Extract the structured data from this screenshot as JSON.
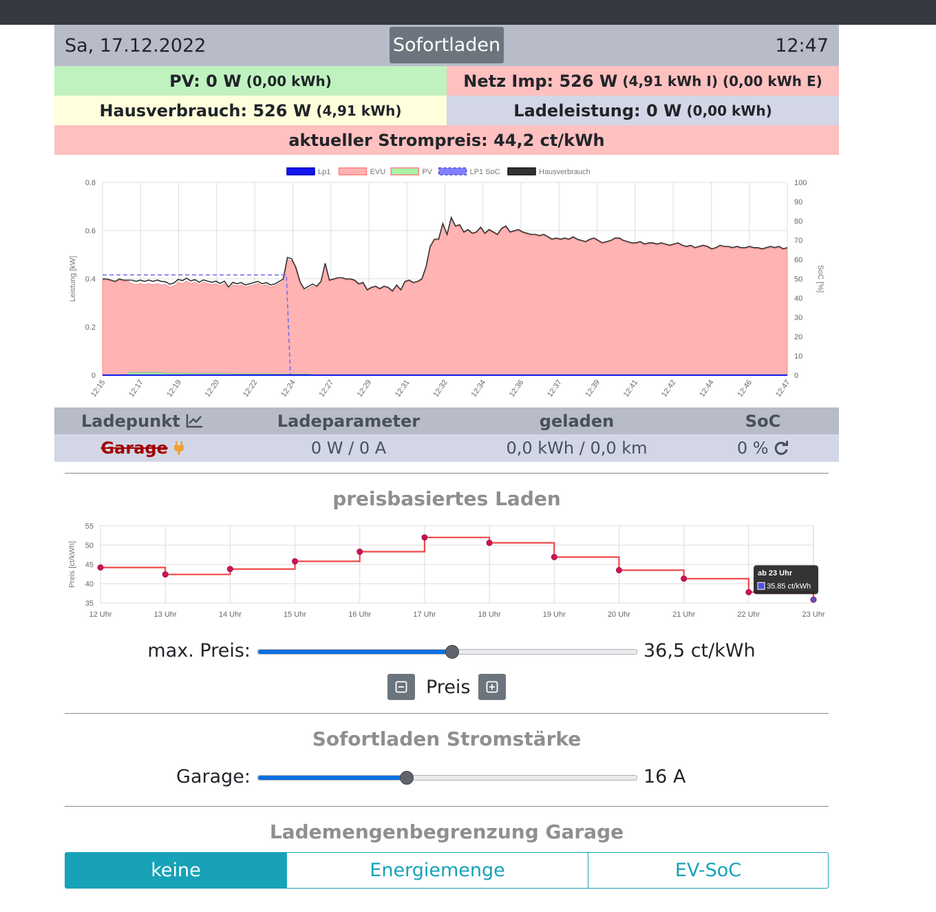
{
  "header": {
    "date": "Sa, 17.12.2022",
    "mode": "Sofortladen",
    "time": "12:47"
  },
  "summary": {
    "pv_label": "PV: 0 W",
    "pv_sub": "(0,00 kWh)",
    "netz_label": "Netz Imp: 526 W",
    "netz_sub": "(4,91 kWh I) (0,00 kWh E)",
    "haus_label": "Hausverbrauch: 526 W",
    "haus_sub": "(4,91 kWh)",
    "lade_label": "Ladeleistung: 0 W",
    "lade_sub": "(0,00 kWh)",
    "preis_label": "aktueller Strompreis: 44,2 ct/kWh"
  },
  "colors": {
    "header_bg": "#b8bcc8",
    "pv_bg": "#c0f2c0",
    "netz_bg": "#ffc0c0",
    "haus_bg": "#ffffdc",
    "lade_bg": "#d2d6e6",
    "accent": "#17a2b8",
    "slider_fill": "#0b6fe0"
  },
  "chart_data": [
    {
      "type": "area",
      "legend": [
        "Lp1",
        "EVU",
        "PV",
        "LP1 SoC",
        "Hausverbrauch"
      ],
      "legend_colors": [
        "#1515f0",
        "#ffb3b3",
        "#a8f5a8",
        "#8080ff",
        "#333333"
      ],
      "legend_placement": "top",
      "ylabel_left": "Leistung [kW]",
      "ylabel_right": "SoC [%]",
      "ylim_left": [
        0,
        0.8
      ],
      "yticks_left": [
        "0",
        "0.2",
        "0.4",
        "0.6",
        "0.8"
      ],
      "ylim_right": [
        0,
        100
      ],
      "yticks_right": [
        "0",
        "10",
        "20",
        "30",
        "40",
        "50",
        "60",
        "70",
        "80",
        "90",
        "100"
      ],
      "x_ticks": [
        "12:15",
        "12:17",
        "12:19",
        "12:20",
        "12:22",
        "12:24",
        "12:27",
        "12:29",
        "12:31",
        "12:32",
        "12:34",
        "12:36",
        "12:37",
        "12:39",
        "12:41",
        "12:42",
        "12:44",
        "12:46",
        "12:47"
      ],
      "grid": true,
      "series": [
        {
          "name": "EVU",
          "values": [
            0.395,
            0.395,
            0.39,
            0.385,
            0.395,
            0.39,
            0.39,
            0.38,
            0.375,
            0.38,
            0.375,
            0.38,
            0.375,
            0.38,
            0.375,
            0.375,
            0.365,
            0.37,
            0.385,
            0.38,
            0.39,
            0.38,
            0.385,
            0.375,
            0.385,
            0.38,
            0.375,
            0.38,
            0.37,
            0.38,
            0.355,
            0.375,
            0.37,
            0.375,
            0.365,
            0.37,
            0.375,
            0.38,
            0.37,
            0.375,
            0.365,
            0.37,
            0.38,
            0.39,
            0.48,
            0.475,
            0.44,
            0.38,
            0.35,
            0.36,
            0.37,
            0.365,
            0.385,
            0.46,
            0.39,
            0.395,
            0.4,
            0.4,
            0.395,
            0.395,
            0.39,
            0.375,
            0.38,
            0.35,
            0.36,
            0.365,
            0.355,
            0.365,
            0.36,
            0.345,
            0.37,
            0.35,
            0.385,
            0.39,
            0.38,
            0.385,
            0.395,
            0.445,
            0.53,
            0.56,
            0.56,
            0.625,
            0.58,
            0.65,
            0.615,
            0.62,
            0.59,
            0.6,
            0.585,
            0.59,
            0.61,
            0.585,
            0.6,
            0.59,
            0.58,
            0.605,
            0.615,
            0.59,
            0.595,
            0.6,
            0.59,
            0.585,
            0.58,
            0.58,
            0.575,
            0.58,
            0.57,
            0.56,
            0.565,
            0.56,
            0.565,
            0.56,
            0.57,
            0.56,
            0.555,
            0.55,
            0.56,
            0.565,
            0.555,
            0.545,
            0.55,
            0.555,
            0.565,
            0.565,
            0.555,
            0.55,
            0.545,
            0.545,
            0.55,
            0.54,
            0.545,
            0.545,
            0.54,
            0.545,
            0.54,
            0.535,
            0.54,
            0.545,
            0.535,
            0.53,
            0.535,
            0.525,
            0.53,
            0.535,
            0.53,
            0.52,
            0.525,
            0.535,
            0.53,
            0.53,
            0.525,
            0.53,
            0.525,
            0.525,
            0.53,
            0.525,
            0.525,
            0.52,
            0.525,
            0.53,
            0.525,
            0.53,
            0.52,
            0.525
          ]
        },
        {
          "name": "PV",
          "values": [
            0,
            0,
            0,
            0,
            0,
            0,
            0,
            0.01,
            0.01,
            0.01,
            0.01,
            0.01,
            0.01,
            0.01,
            0.01,
            0.01,
            0.008,
            0.008,
            0.008,
            0.008,
            0.008,
            0.008,
            0.007,
            0.007,
            0.006,
            0.006,
            0.006,
            0.006,
            0.006,
            0.006,
            0.006,
            0.006,
            0.006,
            0.006,
            0.005,
            0.005,
            0.005,
            0.005,
            0.005,
            0.005,
            0.005,
            0.005,
            0.005,
            0.005,
            0.004,
            0.004,
            0.004,
            0.004,
            0.004,
            0.004,
            0.004,
            0.004,
            0.004,
            0.004,
            0,
            0,
            0,
            0,
            0,
            0
          ]
        },
        {
          "name": "LP1 SoC",
          "values": [
            52,
            52,
            52,
            52,
            52,
            52,
            52,
            52,
            52,
            52,
            52,
            52,
            52,
            52,
            52,
            52,
            52,
            52,
            52,
            52,
            52,
            52,
            52,
            52,
            52,
            52,
            52,
            52,
            52,
            52,
            52,
            52,
            52,
            52,
            52,
            52,
            52,
            52,
            52,
            52,
            52,
            52,
            52,
            52,
            52,
            52,
            52,
            0,
            0,
            0
          ]
        },
        {
          "name": "Lp1",
          "values": [
            0,
            0
          ]
        }
      ]
    },
    {
      "type": "line",
      "step": true,
      "ylabel": "Preis [ct/kWh]",
      "ylim": [
        35,
        55
      ],
      "yticks": [
        "35",
        "40",
        "45",
        "50",
        "55"
      ],
      "categories": [
        "12 Uhr",
        "13 Uhr",
        "14 Uhr",
        "15 Uhr",
        "16 Uhr",
        "17 Uhr",
        "18 Uhr",
        "19 Uhr",
        "20 Uhr",
        "21 Uhr",
        "22 Uhr",
        "23 Uhr"
      ],
      "values": [
        44.2,
        42.4,
        43.8,
        45.8,
        48.3,
        52.0,
        50.6,
        46.9,
        43.5,
        41.3,
        37.8,
        35.85
      ],
      "grid": true,
      "tooltip_title": "ab 23 Uhr",
      "tooltip_value": "35.85 ct/kWh"
    }
  ],
  "ladepunkt_table": {
    "headers": [
      "Ladepunkt",
      "Ladeparameter",
      "geladen",
      "SoC"
    ],
    "row": {
      "name": "Garage",
      "params": "0 W / 0 A",
      "geladen": "0,0 kWh / 0,0 km",
      "soc": "0 %"
    }
  },
  "preis_section": {
    "title": "preisbasiertes Laden",
    "max_label": "max. Preis:",
    "max_value": "36,5 ct/kWh",
    "slider_fraction": 0.51,
    "preis_label": "Preis",
    "minus_icon": "minus-square-icon",
    "plus_icon": "plus-square-icon"
  },
  "sofort_section": {
    "title": "Sofortladen Stromstärke",
    "garage_label": "Garage:",
    "value": "16 A",
    "slider_fraction": 0.39
  },
  "limit_section": {
    "title": "Lademengenbegrenzung Garage",
    "buttons": [
      "keine",
      "Energiemenge",
      "EV-SoC"
    ],
    "active": "keine"
  }
}
